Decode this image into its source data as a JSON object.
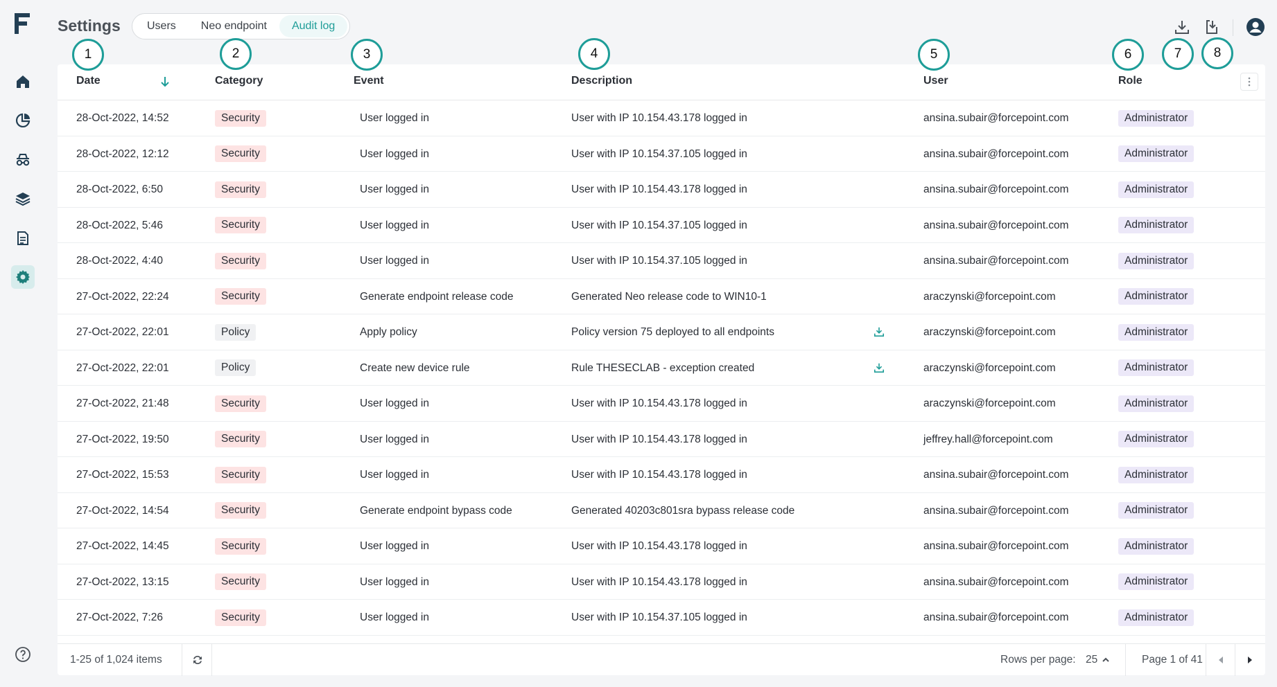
{
  "app": {
    "title": "Settings"
  },
  "tabs": [
    {
      "label": "Users"
    },
    {
      "label": "Neo endpoint"
    },
    {
      "label": "Audit log",
      "active": true
    }
  ],
  "sidebar": {
    "logo": "forcepoint-logo-icon",
    "items": [
      {
        "icon": "home-icon"
      },
      {
        "icon": "pie-chart-icon"
      },
      {
        "icon": "incognito-icon"
      },
      {
        "icon": "layers-icon"
      },
      {
        "icon": "document-icon"
      },
      {
        "icon": "gear-icon",
        "active": true
      }
    ],
    "help_icon": "help-icon"
  },
  "top_actions": [
    "download-icon",
    "export-icon",
    "user-avatar-icon"
  ],
  "callouts": [
    "1",
    "2",
    "3",
    "4",
    "5",
    "6",
    "7",
    "8"
  ],
  "table": {
    "columns": {
      "date": "Date",
      "category": "Category",
      "event": "Event",
      "description": "Description",
      "user": "User",
      "role": "Role"
    },
    "rows": [
      {
        "date": "28-Oct-2022, 14:52",
        "category": "Security",
        "event": "User logged in",
        "description": "User with IP 10.154.43.178 logged in",
        "download": false,
        "user": "ansina.subair@forcepoint.com",
        "role": "Administrator"
      },
      {
        "date": "28-Oct-2022, 12:12",
        "category": "Security",
        "event": "User logged in",
        "description": "User with IP 10.154.37.105 logged in",
        "download": false,
        "user": "ansina.subair@forcepoint.com",
        "role": "Administrator"
      },
      {
        "date": "28-Oct-2022, 6:50",
        "category": "Security",
        "event": "User logged in",
        "description": "User with IP 10.154.43.178 logged in",
        "download": false,
        "user": "ansina.subair@forcepoint.com",
        "role": "Administrator"
      },
      {
        "date": "28-Oct-2022, 5:46",
        "category": "Security",
        "event": "User logged in",
        "description": "User with IP 10.154.37.105 logged in",
        "download": false,
        "user": "ansina.subair@forcepoint.com",
        "role": "Administrator"
      },
      {
        "date": "28-Oct-2022, 4:40",
        "category": "Security",
        "event": "User logged in",
        "description": "User with IP 10.154.37.105 logged in",
        "download": false,
        "user": "ansina.subair@forcepoint.com",
        "role": "Administrator"
      },
      {
        "date": "27-Oct-2022, 22:24",
        "category": "Security",
        "event": "Generate endpoint release code",
        "description": "Generated Neo release code to WIN10-1",
        "download": false,
        "user": "araczynski@forcepoint.com",
        "role": "Administrator"
      },
      {
        "date": "27-Oct-2022, 22:01",
        "category": "Policy",
        "event": "Apply policy",
        "description": "Policy version 75 deployed to all endpoints",
        "download": true,
        "user": "araczynski@forcepoint.com",
        "role": "Administrator"
      },
      {
        "date": "27-Oct-2022, 22:01",
        "category": "Policy",
        "event": "Create new device rule",
        "description": "Rule THESECLAB - exception created",
        "download": true,
        "user": "araczynski@forcepoint.com",
        "role": "Administrator"
      },
      {
        "date": "27-Oct-2022, 21:48",
        "category": "Security",
        "event": "User logged in",
        "description": "User with IP 10.154.43.178 logged in",
        "download": false,
        "user": "araczynski@forcepoint.com",
        "role": "Administrator"
      },
      {
        "date": "27-Oct-2022, 19:50",
        "category": "Security",
        "event": "User logged in",
        "description": "User with IP 10.154.43.178 logged in",
        "download": false,
        "user": "jeffrey.hall@forcepoint.com",
        "role": "Administrator"
      },
      {
        "date": "27-Oct-2022, 15:53",
        "category": "Security",
        "event": "User logged in",
        "description": "User with IP 10.154.43.178 logged in",
        "download": false,
        "user": "ansina.subair@forcepoint.com",
        "role": "Administrator"
      },
      {
        "date": "27-Oct-2022, 14:54",
        "category": "Security",
        "event": "Generate endpoint bypass code",
        "description": "Generated 40203c801sra bypass release code",
        "download": false,
        "user": "ansina.subair@forcepoint.com",
        "role": "Administrator"
      },
      {
        "date": "27-Oct-2022, 14:45",
        "category": "Security",
        "event": "User logged in",
        "description": "User with IP 10.154.43.178 logged in",
        "download": false,
        "user": "ansina.subair@forcepoint.com",
        "role": "Administrator"
      },
      {
        "date": "27-Oct-2022, 13:15",
        "category": "Security",
        "event": "User logged in",
        "description": "User with IP 10.154.43.178 logged in",
        "download": false,
        "user": "ansina.subair@forcepoint.com",
        "role": "Administrator"
      },
      {
        "date": "27-Oct-2022, 7:26",
        "category": "Security",
        "event": "User logged in",
        "description": "User with IP 10.154.37.105 logged in",
        "download": false,
        "user": "ansina.subair@forcepoint.com",
        "role": "Administrator"
      }
    ]
  },
  "footer": {
    "items_count": "1-25 of 1,024 items",
    "rows_per_page_label": "Rows per page:",
    "rows_per_page_value": "25",
    "page_label": "Page 1 of 41"
  },
  "colors": {
    "accent": "#1e9d98",
    "security_badge": "#fde3e3",
    "policy_badge": "#f0f1f3",
    "role_badge": "#ece8f8",
    "active_nav": "#d7ecec"
  }
}
